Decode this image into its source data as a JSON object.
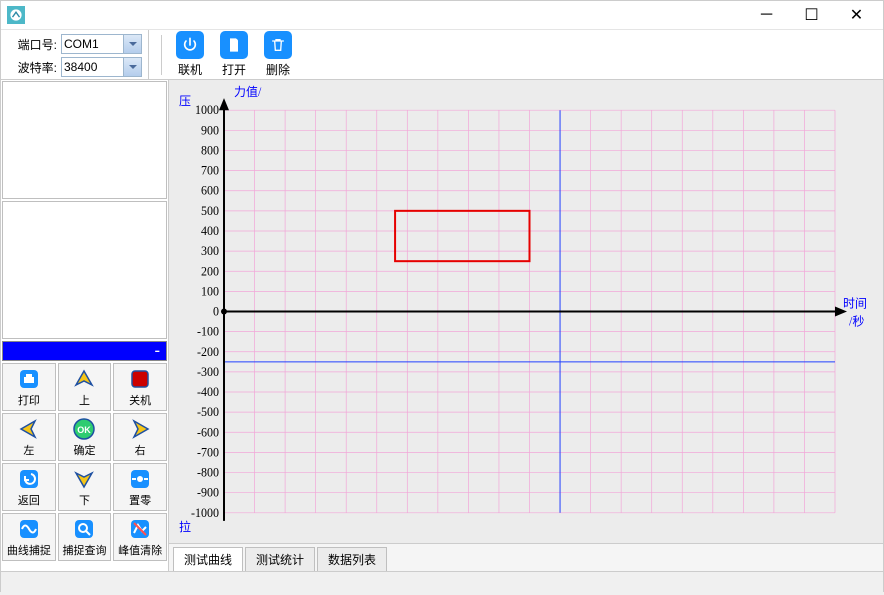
{
  "titlebar": {
    "title": ""
  },
  "port": {
    "port_label": "端口号:",
    "port_value": "COM1",
    "baud_label": "波特率:",
    "baud_value": "38400"
  },
  "toolbar": {
    "connect": "联机",
    "open": "打开",
    "delete": "删除"
  },
  "display": {
    "value": "-"
  },
  "buttons": {
    "print": "打印",
    "up": "上",
    "power": "关机",
    "left": "左",
    "ok": "确定",
    "right": "右",
    "back": "返回",
    "down": "下",
    "zero": "置零",
    "capture": "曲线捕捉",
    "query": "捕捉查询",
    "clear": "峰值清除"
  },
  "tabs": {
    "curve": "测试曲线",
    "stats": "测试统计",
    "data": "数据列表"
  },
  "chart_data": {
    "type": "line",
    "y_axis_title": "力值/",
    "y_top_label": "压",
    "y_bottom_label": "拉",
    "x_axis_title": "时间/秒",
    "ylim": [
      -1000,
      1000
    ],
    "y_ticks": [
      1000,
      900,
      800,
      700,
      600,
      500,
      400,
      300,
      200,
      100,
      0,
      -100,
      -200,
      -300,
      -400,
      -500,
      -600,
      -700,
      -800,
      -900,
      -1000
    ],
    "x_ticks_count": 20,
    "vertical_cursor_x_fraction": 0.55,
    "highlight_rect": {
      "x0_fraction": 0.28,
      "y0": 500,
      "x1_fraction": 0.5,
      "y1": 250
    },
    "series": []
  }
}
